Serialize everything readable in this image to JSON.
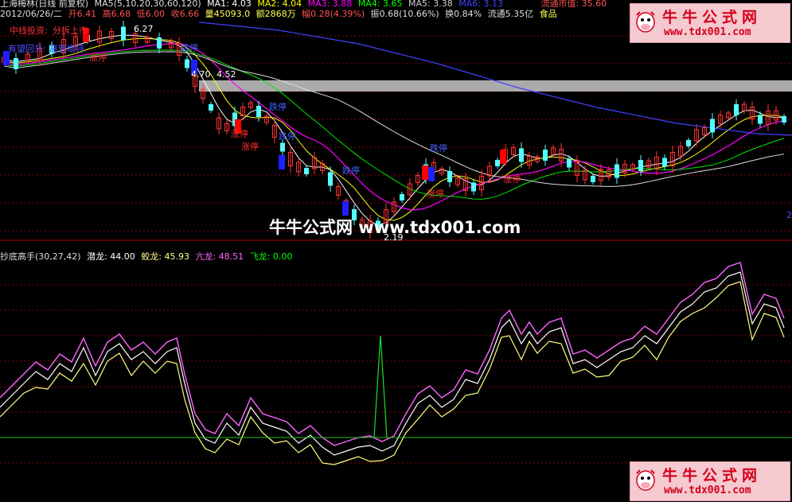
{
  "header": {
    "line1": {
      "stock": "上海梅林(日线 前复权)",
      "ma_params": "MA5(5,10,20,30,60,120)",
      "ma1": "MA1: 4.03",
      "ma2": "MA2: 4.04",
      "ma3": "MA3: 3.88",
      "ma4": "MA4: 3.65",
      "ma5": "MA5: 3.38",
      "ma6": "MA6: 3.13",
      "market_cap": "流通市值: 35.60"
    },
    "line2": {
      "date": "2012/06/26/二",
      "open": "开6.41",
      "high": "高6.68",
      "low": "低6.00",
      "close": "收6.66",
      "volume": "量45093.0",
      "amount": "额2868万",
      "change": "幅0.28(4.39%)",
      "amplitude": "振0.68(10.66%)",
      "turnover": "换0.84%",
      "float": "流通5.35亿",
      "industry": "食品"
    }
  },
  "main_chart": {
    "labels": {
      "zhongxian": "中线投资: ",
      "fenjia": "分拆上市",
      "gudong": "有望回升: ",
      "gaoyin": "高管增持",
      "price_high": "6.27",
      "price_mid1": "4.70",
      "price_mid2": "4.52",
      "price_low": "2.19",
      "zhangting": "涨停",
      "dieting": "跌停"
    },
    "right_marker": "2"
  },
  "indicator": {
    "name": "抄底高手(30,27,42)",
    "qianlong": "潜龙: 44.00",
    "jiaolong": "蛟龙: 45.93",
    "kanglong": "亢龙: 48.51",
    "feilong": "飞龙: 0.00"
  },
  "watermark": {
    "brand": "牛牛公式网",
    "url": "www.tdx001.com",
    "center": "牛牛公式网 www.tdx001.com"
  },
  "colors": {
    "up": "#ff3232",
    "down": "#54ffff",
    "ma_white": "#ffffff",
    "ma_yellow": "#ffff00",
    "ma_magenta": "#ff00ff",
    "ma_green": "#00e600",
    "ma_blue": "#4040ff",
    "indicator_magenta": "#ff64ff",
    "indicator_yellow": "#ffff80",
    "grid_red": "#8c0000"
  }
}
